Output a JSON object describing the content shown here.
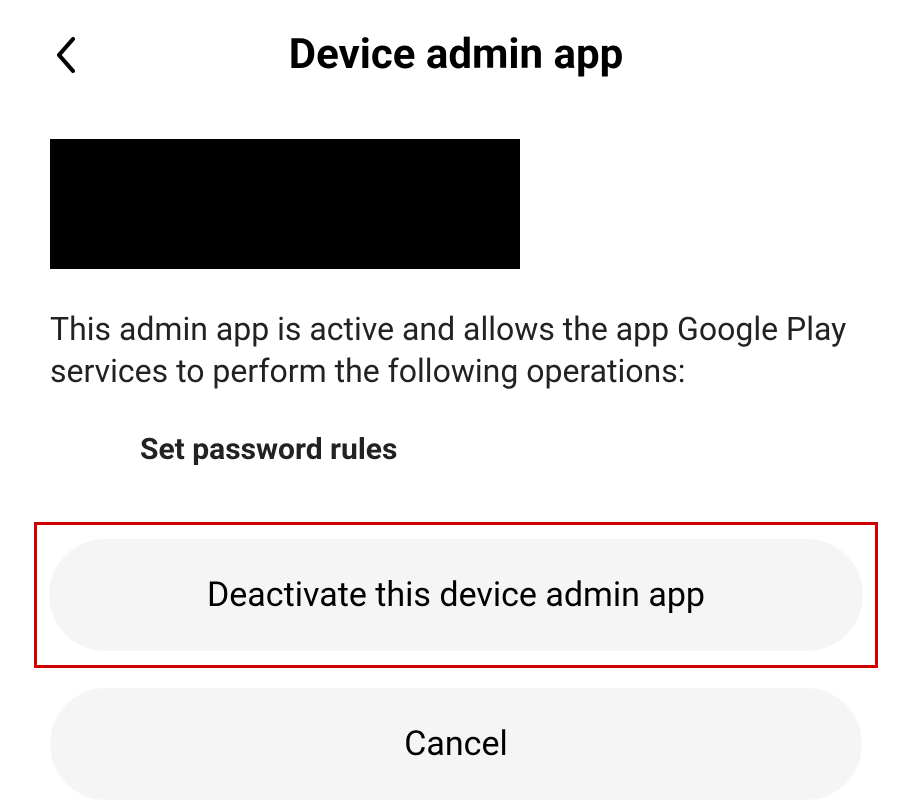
{
  "header": {
    "title": "Device admin app"
  },
  "description": "This admin app is active and allows the app Google Play services to perform the following operations:",
  "operations": {
    "item1": "Set password rules"
  },
  "buttons": {
    "deactivate_label": "Deactivate this device admin app",
    "cancel_label": "Cancel"
  }
}
